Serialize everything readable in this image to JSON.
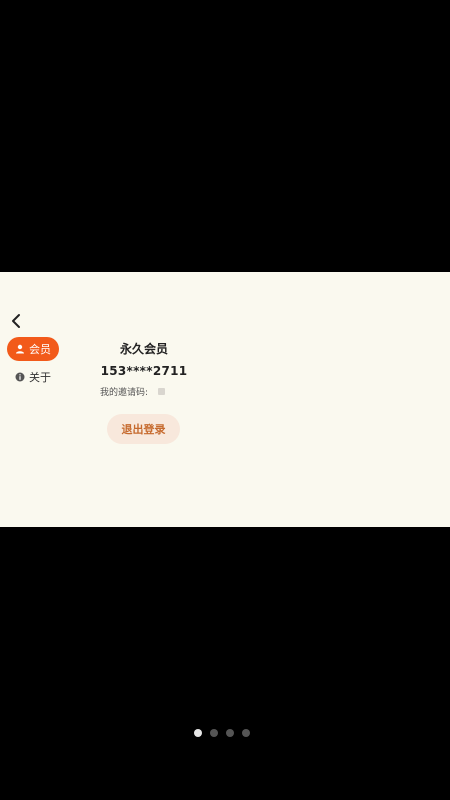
{
  "sidebar": {
    "items": [
      {
        "label": "会员",
        "icon": "user-icon",
        "active": true
      },
      {
        "label": "关于",
        "icon": "info-icon",
        "active": false
      }
    ]
  },
  "member": {
    "tier": "永久会员",
    "phone": "153****2711",
    "invite_label": "我的邀请码:"
  },
  "actions": {
    "logout_label": "退出登录"
  },
  "pager": {
    "count": 4,
    "active_index": 0
  },
  "colors": {
    "accent": "#f25a1a",
    "panel_bg": "#faf9ef",
    "logout_bg": "#f8e8dc",
    "logout_text": "#c66a2e"
  }
}
